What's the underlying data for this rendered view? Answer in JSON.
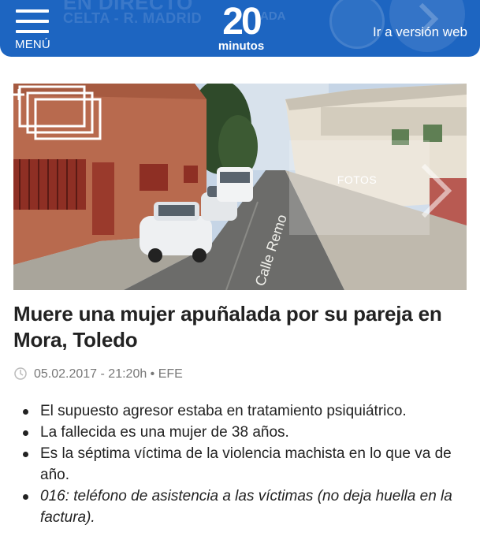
{
  "header": {
    "menu_label": "MENÚ",
    "logo_number": "20",
    "logo_word": "minutos",
    "web_link_label": "Ir a versión web",
    "banner_line1": "EN DIRECTO",
    "banner_line2": "CELTA - R. MADRID",
    "banner_fragment": "ADA",
    "bar_color": "#1d65c1"
  },
  "hero": {
    "gallery_label": "FOTOS",
    "street_sign": "Calle Remo"
  },
  "article": {
    "headline": "Muere una mujer apuñalada por su pareja en Mora, Toledo",
    "meta": "05.02.2017 - 21:20h • EFE",
    "bullets": [
      {
        "text": "El supuesto agresor estaba en tratamiento psiquiátrico.",
        "italic": false
      },
      {
        "text": "La fallecida es una mujer de 38 años.",
        "italic": false
      },
      {
        "text": "Es la séptima víctima de la violencia machista en lo que va de año.",
        "italic": false
      },
      {
        "text": "016: teléfono de asistencia a las víctimas (no deja huella en la factura).",
        "italic": true
      }
    ]
  },
  "icons": {
    "menu": "hamburger-menu-icon",
    "clock": "clock-icon",
    "gallery": "photo-gallery-icon",
    "next": "chevron-right-icon"
  }
}
